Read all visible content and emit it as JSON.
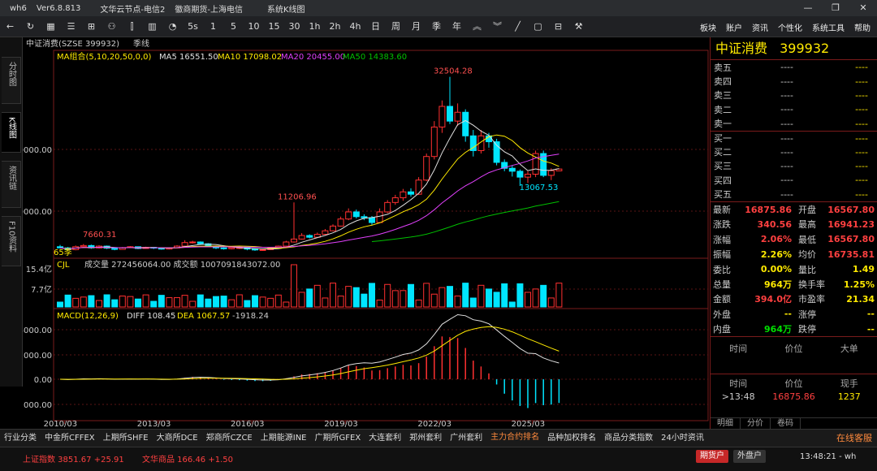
{
  "titlebar": {
    "app": "wh6",
    "version": "Ver6.8.813",
    "node": "文华云节点-电信2",
    "broker": "徽商期货-上海电信",
    "mode": "系统K线图"
  },
  "toolbar": {
    "nums": [
      "5s",
      "1",
      "5",
      "10",
      "15",
      "30",
      "1h",
      "2h",
      "4h",
      "日",
      "周",
      "月",
      "季",
      "年"
    ],
    "menu": [
      "板块",
      "账户",
      "资讯",
      "个性化",
      "系统工具",
      "帮助"
    ]
  },
  "left_tabs": [
    "分时图",
    "K线图",
    "资讯链",
    "F10资料"
  ],
  "chart": {
    "header": {
      "name": "中证消费(SZSE 399932)",
      "period": "季线"
    },
    "ma_label": "MA组合(5,10,20,50,0,0)",
    "ma5": "MA5 16551.50",
    "ma10": "MA10 17098.02",
    "ma20": "MA20 20455.00",
    "ma50": "MA50 14383.60",
    "vol_label": "CJL",
    "vol_text": "成交量 272456064.00  成交额 1007091843072.00",
    "macd_label": "MACD(12,26,9)",
    "diff": "DIFF 108.45",
    "dea": "DEA 1067.57",
    "macd_val": "-1918.24",
    "price_ticks": [
      "20000.00",
      "10000.00"
    ],
    "vol_ticks": [
      "15.4亿",
      "7.7亿"
    ],
    "macd_ticks": [
      "4000.00",
      "2000.00",
      "0.00",
      "-2000.00"
    ],
    "x_labels": [
      "2010/03",
      "2013/03",
      "2016/03",
      "2019/03",
      "2022/03",
      "2025/03"
    ],
    "annotations": {
      "high": "32504.28",
      "l2": "11206.96",
      "l1": "7660.31",
      "low": "13067.53",
      "count": "65季"
    },
    "colors": {
      "up": "#ff3030",
      "down": "#00e5ff",
      "ma5": "#e0e0e0",
      "ma10": "#ffea00",
      "ma20": "#e040fb",
      "ma50": "#00c000"
    }
  },
  "chart_data": {
    "type": "candlestick",
    "title": "中证消费(SZSE 399932) 季线",
    "xlabel": "",
    "ylabel": "",
    "x_labels": [
      "2010/03",
      "2013/03",
      "2016/03",
      "2019/03",
      "2022/03",
      "2025/03"
    ],
    "count": 65,
    "ylim": [
      4500,
      37000
    ],
    "points": [
      [
        3700,
        3500,
        4000,
        3450
      ],
      [
        3500,
        3200,
        3650,
        3050
      ],
      [
        3200,
        3700,
        3900,
        3100
      ],
      [
        3700,
        3900,
        4150,
        3550
      ],
      [
        3900,
        3500,
        4050,
        3350
      ],
      [
        3500,
        3800,
        3950,
        3400
      ],
      [
        3800,
        3450,
        3900,
        3300
      ],
      [
        3450,
        3250,
        3550,
        3100
      ],
      [
        3250,
        3550,
        3650,
        3200
      ],
      [
        3550,
        3700,
        3800,
        3500
      ],
      [
        3700,
        3400,
        3750,
        3300
      ],
      [
        3400,
        3600,
        3700,
        3350
      ],
      [
        3600,
        3500,
        3650,
        3300
      ],
      [
        3500,
        3300,
        3550,
        3200
      ],
      [
        3300,
        3500,
        3600,
        3250
      ],
      [
        3500,
        3800,
        3950,
        3450
      ],
      [
        3800,
        4400,
        4800,
        3750
      ],
      [
        4400,
        4500,
        4700,
        4250
      ],
      [
        4500,
        4200,
        4600,
        4000
      ],
      [
        4200,
        3750,
        4300,
        3650
      ],
      [
        3750,
        3500,
        3900,
        3300
      ],
      [
        3500,
        3350,
        3600,
        3200
      ],
      [
        3350,
        3550,
        3650,
        3250
      ],
      [
        3550,
        3550,
        3750,
        3300
      ],
      [
        3550,
        3300,
        3650,
        3100
      ],
      [
        3300,
        3150,
        3450,
        3000
      ],
      [
        3150,
        3200,
        3300,
        3000
      ],
      [
        3200,
        3400,
        3500,
        3150
      ],
      [
        3400,
        3800,
        3900,
        3350
      ],
      [
        3800,
        4500,
        4700,
        3750
      ],
      [
        4500,
        5000,
        11206,
        4400
      ],
      [
        5000,
        5600,
        6000,
        4900
      ],
      [
        5600,
        5300,
        5800,
        5100
      ],
      [
        5300,
        5800,
        6100,
        5200
      ],
      [
        5800,
        6400,
        6700,
        5700
      ],
      [
        6400,
        7200,
        7500,
        6300
      ],
      [
        7200,
        8400,
        8800,
        7100
      ],
      [
        8400,
        9600,
        10200,
        8200
      ],
      [
        9600,
        8800,
        10000,
        8500
      ],
      [
        8800,
        8600,
        9200,
        8200
      ],
      [
        8600,
        7800,
        8900,
        7400
      ],
      [
        7800,
        9600,
        10200,
        7700
      ],
      [
        9600,
        11200,
        11600,
        9400
      ],
      [
        11200,
        12000,
        12500,
        10800
      ],
      [
        12000,
        13000,
        13500,
        11500
      ],
      [
        13000,
        12600,
        13600,
        12200
      ],
      [
        12600,
        15000,
        15500,
        12500
      ],
      [
        15000,
        19000,
        19500,
        14800
      ],
      [
        19000,
        24000,
        25000,
        18500
      ],
      [
        24000,
        27500,
        28500,
        23000
      ],
      [
        27500,
        25000,
        32504,
        24500
      ],
      [
        25000,
        26500,
        28000,
        24200
      ],
      [
        26500,
        22500,
        27000,
        21500
      ],
      [
        22500,
        20000,
        23500,
        19000
      ],
      [
        20000,
        22500,
        23500,
        19500
      ],
      [
        22500,
        21500,
        23000,
        20500
      ],
      [
        21500,
        18000,
        22000,
        17500
      ],
      [
        18000,
        17000,
        18500,
        16500
      ],
      [
        17000,
        16500,
        17500,
        15600
      ],
      [
        16500,
        15500,
        16800,
        14000
      ],
      [
        15500,
        16000,
        16500,
        14500
      ],
      [
        16000,
        19500,
        20000,
        15500
      ],
      [
        19500,
        15800,
        20000,
        15500
      ],
      [
        15800,
        16600,
        17000,
        15000
      ],
      [
        16567,
        16875,
        16941,
        16567
      ]
    ],
    "series": [
      {
        "name": "MA5"
      },
      {
        "name": "MA10"
      },
      {
        "name": "MA20"
      },
      {
        "name": "MA50"
      }
    ]
  },
  "quote": {
    "title": "中证消费",
    "code": "399932",
    "orders": [
      {
        "label": "卖五",
        "price": "----",
        "vol": "----"
      },
      {
        "label": "卖四",
        "price": "----",
        "vol": "----"
      },
      {
        "label": "卖三",
        "price": "----",
        "vol": "----"
      },
      {
        "label": "卖二",
        "price": "----",
        "vol": "----"
      },
      {
        "label": "卖一",
        "price": "----",
        "vol": "----"
      },
      {
        "label": "买一",
        "price": "----",
        "vol": "----"
      },
      {
        "label": "买二",
        "price": "----",
        "vol": "----"
      },
      {
        "label": "买三",
        "price": "----",
        "vol": "----"
      },
      {
        "label": "买四",
        "price": "----",
        "vol": "----"
      },
      {
        "label": "买五",
        "price": "----",
        "vol": "----"
      }
    ],
    "stats": [
      {
        "k1": "最新",
        "v1": "16875.86",
        "c1": "red",
        "k2": "开盘",
        "v2": "16567.80",
        "c2": "red"
      },
      {
        "k1": "涨跌",
        "v1": "340.56",
        "c1": "red",
        "k2": "最高",
        "v2": "16941.23",
        "c2": "red"
      },
      {
        "k1": "涨幅",
        "v1": "2.06%",
        "c1": "red",
        "k2": "最低",
        "v2": "16567.80",
        "c2": "red"
      },
      {
        "k1": "振幅",
        "v1": "2.26%",
        "c1": "yel",
        "k2": "均价",
        "v2": "16735.81",
        "c2": "red"
      },
      {
        "k1": "委比",
        "v1": "0.00%",
        "c1": "yel",
        "k2": "量比",
        "v2": "1.49",
        "c2": "yel"
      },
      {
        "k1": "总量",
        "v1": "964万",
        "c1": "yel",
        "k2": "换手率",
        "v2": "1.25%",
        "c2": "yel"
      },
      {
        "k1": "金额",
        "v1": "394.0亿",
        "c1": "red",
        "k2": "市盈率",
        "v2": "21.34",
        "c2": "yel"
      },
      {
        "k1": "外盘",
        "v1": "--",
        "c1": "yel",
        "k2": "涨停",
        "v2": "--",
        "c2": "yel"
      },
      {
        "k1": "内盘",
        "v1": "964万",
        "c1": "grn",
        "k2": "跌停",
        "v2": "--",
        "c2": "yel"
      }
    ],
    "tick_header1": [
      "时间",
      "价位",
      "大单"
    ],
    "tick_header2": [
      "时间",
      "价位",
      "现手"
    ],
    "tick": {
      "time": ">13:48",
      "price": "16875.86",
      "vol": "1237"
    },
    "tabs": [
      "明细",
      "分价",
      "卷码"
    ]
  },
  "bottom_tabs": [
    "行业分类",
    "中金所CFFEX",
    "上期所SHFE",
    "大商所DCE",
    "郑商所CZCE",
    "上期能源INE",
    "广期所GFEX",
    "大连套利",
    "郑州套利",
    "广州套利",
    "主力合约排名",
    "品种加权排名",
    "商品分类指数",
    "24小时资讯"
  ],
  "service": "在线客服",
  "status": {
    "idx1": "上证指数 3851.67 +25.91",
    "idx2": "文华商品 166.46 +1.50",
    "btn1": "期货户",
    "btn2": "外盘户",
    "time": "13:48:21 - wh"
  }
}
